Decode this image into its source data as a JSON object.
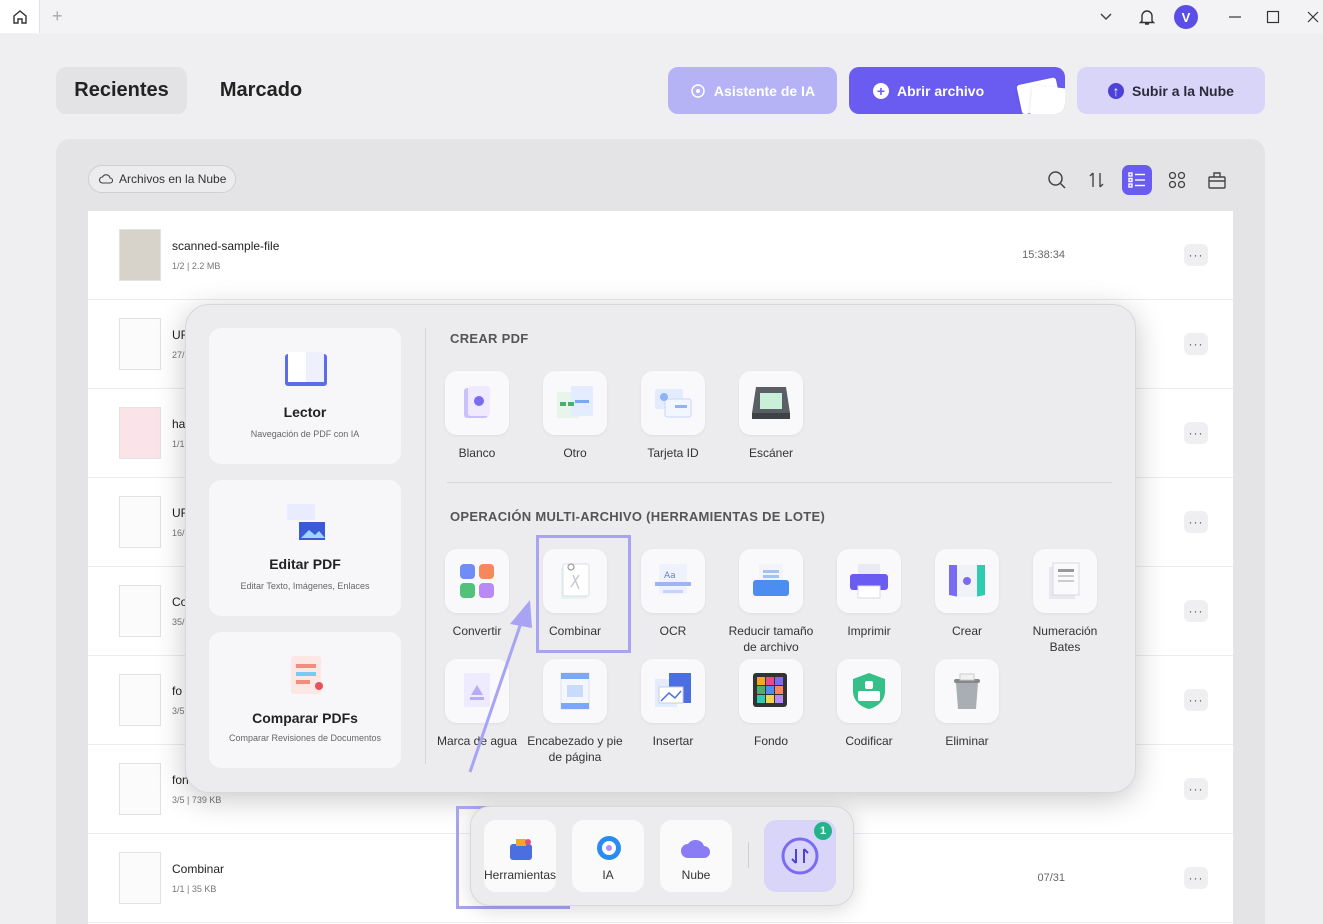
{
  "window": {
    "avatar_letter": "V"
  },
  "header": {
    "tabs": [
      "Recientes",
      "Marcado"
    ],
    "ai_button": "Asistente de IA",
    "open_button": "Abrir archivo",
    "cloud_button": "Subir a la Nube"
  },
  "toolbar": {
    "cloud_files": "Archivos en la Nube"
  },
  "files": [
    {
      "name": "scanned-sample-file",
      "meta": "1/2 | 2.2 MB",
      "time": "15:38:34"
    },
    {
      "name": "UF",
      "meta": "27/",
      "time": ""
    },
    {
      "name": "ha",
      "meta": "1/1",
      "time": ""
    },
    {
      "name": "UF",
      "meta": "16/",
      "time": ""
    },
    {
      "name": "Co",
      "meta": "35/",
      "time": ""
    },
    {
      "name": "fo",
      "meta": "3/5",
      "time": ""
    },
    {
      "name": "fon",
      "meta": "3/5 | 739 KB",
      "time": ""
    },
    {
      "name": "Combinar",
      "meta": "1/1 | 35 KB",
      "time": "07/31"
    }
  ],
  "popup": {
    "left_cards": [
      {
        "title": "Lector",
        "subtitle": "Navegación de PDF con IA"
      },
      {
        "title": "Editar PDF",
        "subtitle": "Editar Texto, Imágenes, Enlaces"
      },
      {
        "title": "Comparar PDFs",
        "subtitle": "Comparar Revisiones de Documentos"
      }
    ],
    "create_section": "CREAR PDF",
    "create_tools": [
      "Blanco",
      "Otro",
      "Tarjeta ID",
      "Escáner"
    ],
    "batch_section": "OPERACIÓN MULTI-ARCHIVO (HERRAMIENTAS DE LOTE)",
    "batch_tools_row1": [
      "Convertir",
      "Combinar",
      "OCR",
      "Reducir tamaño\nde archivo",
      "Imprimir",
      "Crear",
      "Numeración\nBates"
    ],
    "batch_tools_row2": [
      "Marca de agua",
      "Encabezado y pie\nde página",
      "Insertar",
      "Fondo",
      "Codificar",
      "Eliminar"
    ]
  },
  "dock": {
    "items": [
      "Herramientas",
      "IA",
      "Nube"
    ],
    "badge": "1"
  },
  "colors": {
    "accent": "#6a5cf0",
    "highlight": "#a9a3f3",
    "badge": "#22b38a"
  }
}
